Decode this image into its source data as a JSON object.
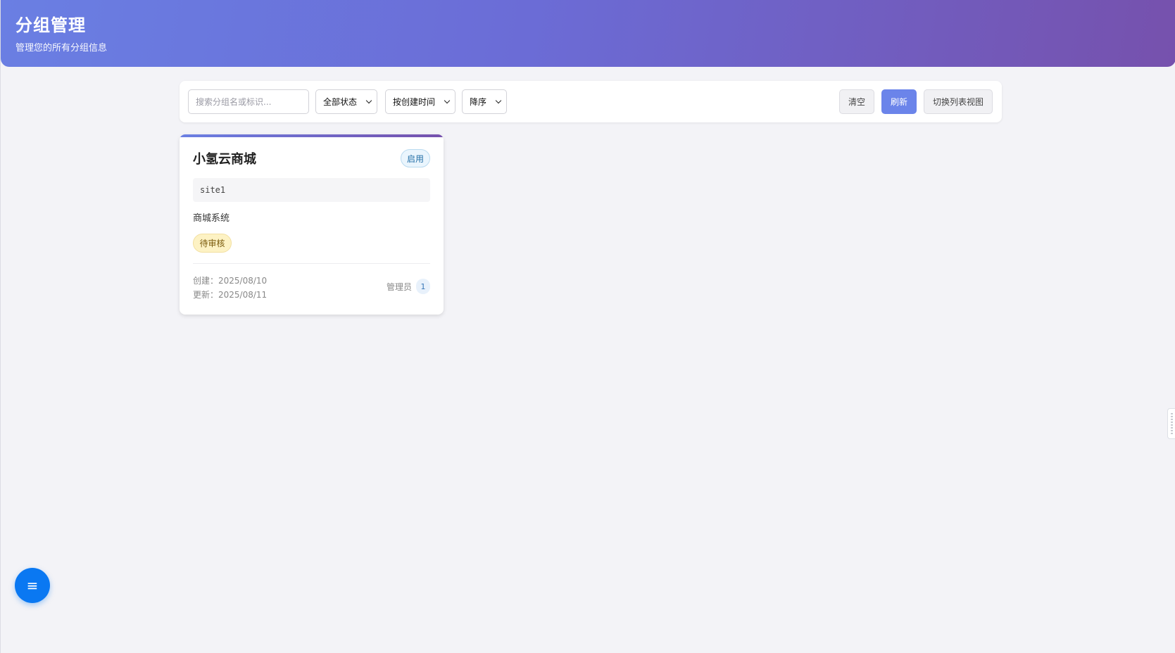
{
  "header": {
    "title": "分组管理",
    "subtitle": "管理您的所有分组信息"
  },
  "toolbar": {
    "search_placeholder": "搜索分组名或标识...",
    "status_filter": "全部状态",
    "sort_by": "按创建时间",
    "sort_order": "降序",
    "clear_label": "清空",
    "refresh_label": "刷新",
    "toggle_view_label": "切换列表视图"
  },
  "groups": [
    {
      "name": "小氢云商城",
      "status": "启用",
      "code": "site1",
      "description": "商城系统",
      "tag": "待审核",
      "created_label": "创建：",
      "created": "2025/08/10",
      "updated_label": "更新：",
      "updated": "2025/08/11",
      "admin_label": "管理员",
      "admin_count": "1"
    }
  ],
  "fab": {
    "icon": "menu-icon",
    "glyph": "≡"
  },
  "colors": {
    "header_gradient_start": "#6a7fe3",
    "header_gradient_end": "#7651ad",
    "primary_button": "#6b84ea",
    "fab": "#0a78f2",
    "status_enabled": "#2470a8",
    "tag_pending_bg": "#fdf2c4"
  }
}
